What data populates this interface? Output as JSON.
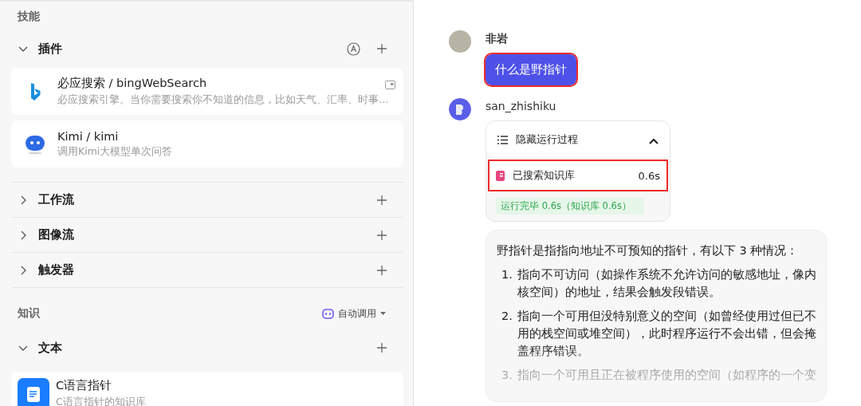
{
  "skills_panel": {
    "title": "技能",
    "plugin_section": {
      "title": "插件",
      "expanded": true,
      "plugins": [
        {
          "kind": "bing",
          "name": "必应搜索 / bingWebSearch",
          "description": "必应搜索引擎。当你需要搜索你不知道的信息，比如天气、汇率、时事…"
        },
        {
          "kind": "kimi",
          "name": "Kimi / kimi",
          "description": "调用Kimi大模型单次问答"
        }
      ]
    },
    "sections": [
      {
        "title": "工作流",
        "expanded": false
      },
      {
        "title": "图像流",
        "expanded": false
      },
      {
        "title": "触发器",
        "expanded": false
      }
    ],
    "knowledge": {
      "title": "知识",
      "mode": "自动调用",
      "text_section": {
        "title": "文本",
        "expanded": true,
        "items": [
          {
            "name": "C语言指针",
            "description": "C语言指针的知识库"
          }
        ]
      }
    }
  },
  "chat": {
    "messages": [
      {
        "kind": "user",
        "author": "非岩",
        "text": "什么是野指针",
        "highlighted": true
      },
      {
        "kind": "bot",
        "author": "san_zhishiku",
        "process": {
          "toggle_label": "隐藏运行过程",
          "expanded": true,
          "steps": [
            {
              "label": "已搜索知识库",
              "duration": "0.6s",
              "highlighted": true
            }
          ],
          "summary": "运行完毕 0.6s（知识库 0.6s）"
        },
        "answer": {
          "intro": "野指针是指指向地址不可预知的指针，有以下 3 种情况：",
          "items": [
            {
              "number": "1.",
              "text": "指向不可访问（如操作系统不允许访问的敏感地址，像内核空间）的地址，结果会触发段错误。"
            },
            {
              "number": "2.",
              "text": "指向一个可用但没特别意义的空间（如曾经使用过但已不用的栈空间或堆空间），此时程序运行不会出错，但会掩盖程序错误。"
            },
            {
              "number": "3.",
              "text": "指向一个可用且正在被程序使用的空间（如程序的一个变"
            }
          ]
        }
      }
    ]
  }
}
